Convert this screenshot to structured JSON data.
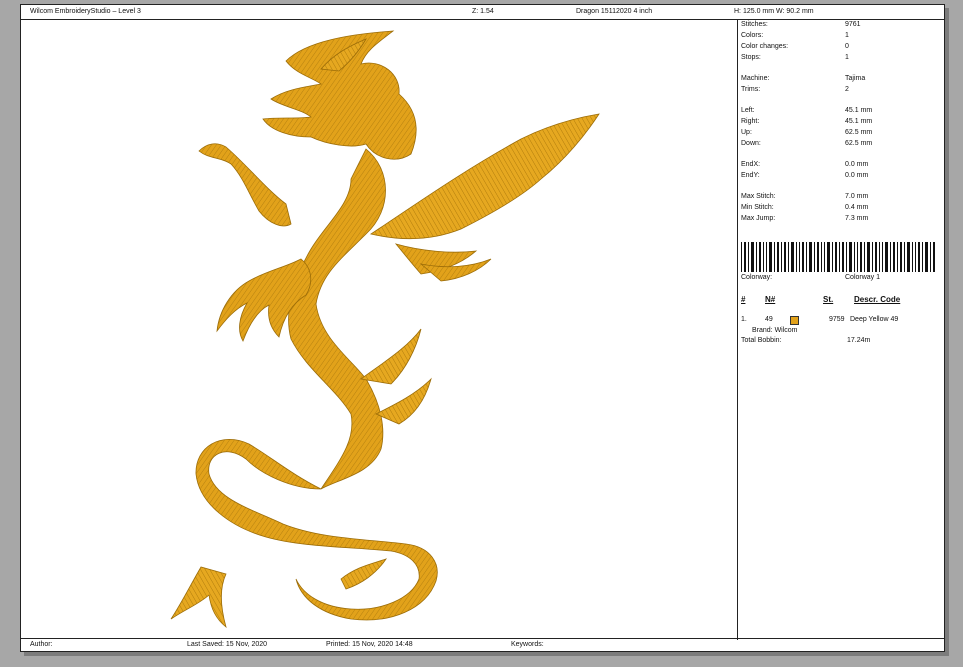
{
  "header": {
    "app_title": "Wilcom EmbroideryStudio – Level 3",
    "zoom": "Z: 1.54",
    "design_name": "Dragon 15112020 4 inch",
    "dimensions": "H: 125.0 mm   W: 90.2 mm"
  },
  "stats": {
    "stitches": {
      "label": "Stitches:",
      "value": "9761"
    },
    "colors": {
      "label": "Colors:",
      "value": "1"
    },
    "color_changes": {
      "label": "Color changes:",
      "value": "0"
    },
    "stops": {
      "label": "Stops:",
      "value": "1"
    },
    "machine": {
      "label": "Machine:",
      "value": "Tajima"
    },
    "trims": {
      "label": "Trims:",
      "value": "2"
    },
    "left": {
      "label": "Left:",
      "value": "45.1 mm"
    },
    "right": {
      "label": "Right:",
      "value": "45.1 mm"
    },
    "up": {
      "label": "Up:",
      "value": "62.5 mm"
    },
    "down": {
      "label": "Down:",
      "value": "62.5 mm"
    },
    "endx": {
      "label": "EndX:",
      "value": "0.0 mm"
    },
    "endy": {
      "label": "EndY:",
      "value": "0.0 mm"
    },
    "max_stitch": {
      "label": "Max Stitch:",
      "value": "7.0 mm"
    },
    "min_stitch": {
      "label": "Min Stitch:",
      "value": "0.4 mm"
    },
    "max_jump": {
      "label": "Max Jump:",
      "value": "7.3 mm"
    }
  },
  "colorway": {
    "label": "Colorway:",
    "value": "Colorway 1"
  },
  "color_table": {
    "headers": {
      "index": "#",
      "number": "N#",
      "stitches": "St.",
      "descr_code": "Descr. Code"
    },
    "rows": [
      {
        "index": "1.",
        "number": "49",
        "swatch_color": "#e2a21a",
        "stitches": "9759",
        "descr": "Deep Yellow 49",
        "brand": "Brand: Wilcom"
      }
    ]
  },
  "bobbin": {
    "label": "Total Bobbin:",
    "value": "17.24m"
  },
  "footer": {
    "author": "Author:",
    "last_saved": "Last Saved: 15 Nov, 2020",
    "printed": "Printed: 15 Nov, 2020 14:48",
    "keywords": "Keywords:"
  },
  "colors": {
    "background": "#a7a7a7",
    "thread": "#e2a21a",
    "thread_dark": "#b07c0c"
  },
  "design_icon": "dragon-embroidery"
}
